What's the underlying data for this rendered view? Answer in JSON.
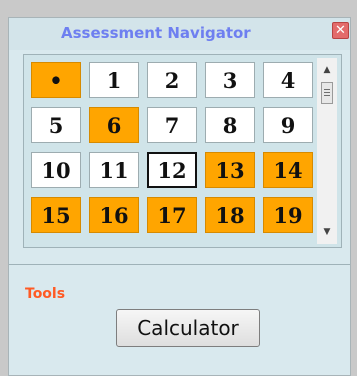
{
  "window": {
    "title": "Assessment Navigator",
    "close_icon": "close-icon",
    "close_glyph": "✕"
  },
  "navigator": {
    "questions": [
      {
        "label": "•",
        "status": "answered",
        "current": false
      },
      {
        "label": "1",
        "status": "unanswered",
        "current": false
      },
      {
        "label": "2",
        "status": "unanswered",
        "current": false
      },
      {
        "label": "3",
        "status": "unanswered",
        "current": false
      },
      {
        "label": "4",
        "status": "unanswered",
        "current": false
      },
      {
        "label": "5",
        "status": "unanswered",
        "current": false
      },
      {
        "label": "6",
        "status": "answered",
        "current": false
      },
      {
        "label": "7",
        "status": "unanswered",
        "current": false
      },
      {
        "label": "8",
        "status": "unanswered",
        "current": false
      },
      {
        "label": "9",
        "status": "unanswered",
        "current": false
      },
      {
        "label": "10",
        "status": "unanswered",
        "current": false
      },
      {
        "label": "11",
        "status": "unanswered",
        "current": false
      },
      {
        "label": "12",
        "status": "unanswered",
        "current": true
      },
      {
        "label": "13",
        "status": "answered",
        "current": false
      },
      {
        "label": "14",
        "status": "answered",
        "current": false
      },
      {
        "label": "15",
        "status": "answered",
        "current": false
      },
      {
        "label": "16",
        "status": "answered",
        "current": false
      },
      {
        "label": "17",
        "status": "answered",
        "current": false
      },
      {
        "label": "18",
        "status": "answered",
        "current": false
      },
      {
        "label": "19",
        "status": "answered",
        "current": false
      }
    ],
    "colors": {
      "answered": "#ffa500",
      "unanswered": "#ffffff"
    },
    "scrollbar": {
      "up_glyph": "▲",
      "down_glyph": "▼"
    }
  },
  "tools": {
    "label": "Tools",
    "calculator_label": "Calculator"
  }
}
